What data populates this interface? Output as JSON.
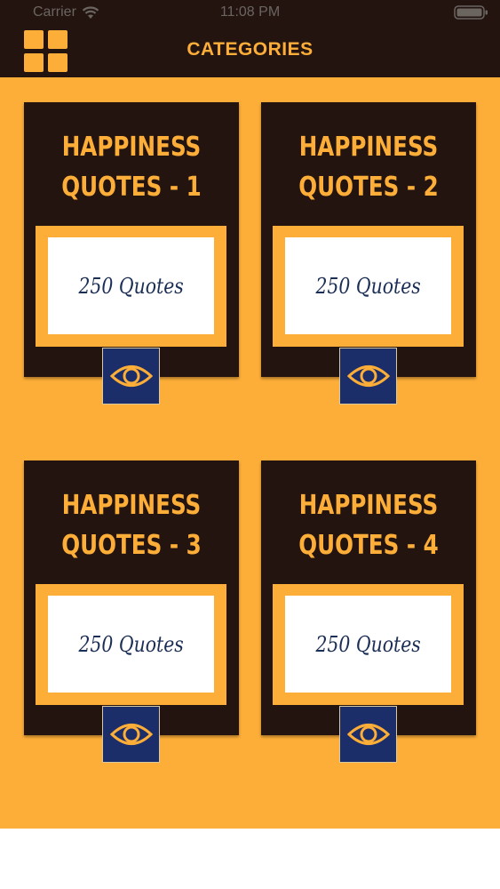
{
  "status_bar": {
    "carrier": "Carrier",
    "time": "11:08 PM"
  },
  "header": {
    "title": "CATEGORIES"
  },
  "colors": {
    "accent": "#FDAE38",
    "dark": "#231410",
    "navy": "#1B2E6A",
    "text_navy": "#1B2E55"
  },
  "categories": [
    {
      "title": "HAPPINESS\nQUOTES - 1",
      "count": "250 Quotes"
    },
    {
      "title": "HAPPINESS\nQUOTES - 2",
      "count": "250 Quotes"
    },
    {
      "title": "HAPPINESS\nQUOTES - 3",
      "count": "250 Quotes"
    },
    {
      "title": "HAPPINESS\nQUOTES - 4",
      "count": "250 Quotes"
    }
  ]
}
